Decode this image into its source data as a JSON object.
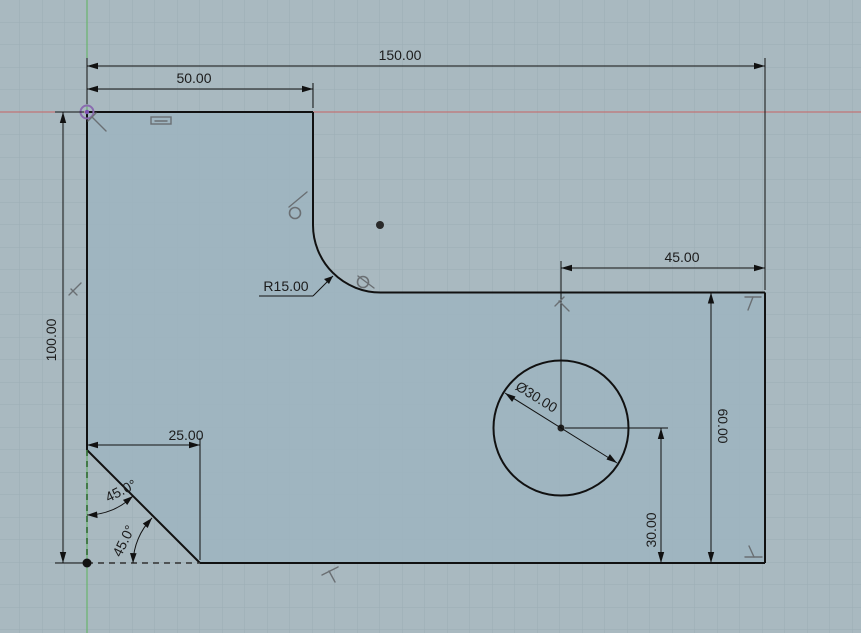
{
  "sketch": {
    "dimensions": {
      "overall_width": "150.00",
      "top_width": "50.00",
      "right_step": "45.00",
      "overall_height": "100.00",
      "right_height": "60.00",
      "hole_height": "30.00",
      "chamfer_width": "25.00",
      "fillet_radius": "R15.00",
      "hole_diameter": "Ø30.00",
      "angle_upper": "45.0°",
      "angle_lower": "45.0°"
    },
    "colors": {
      "background": "#a9b9c0",
      "profile_fill": "#9fb5c1",
      "grid_minor": "#9aabb3",
      "grid_major": "#8fa0a8",
      "x_axis": "#c05a5a",
      "y_axis": "#5ab05a",
      "geometry": "#111111"
    },
    "icons": [
      "origin-point-icon",
      "horizontal-constraint-icon",
      "vertical-constraint-icon",
      "tangent-constraint-icon",
      "perpendicular-constraint-icon",
      "fix-constraint-icon"
    ]
  }
}
